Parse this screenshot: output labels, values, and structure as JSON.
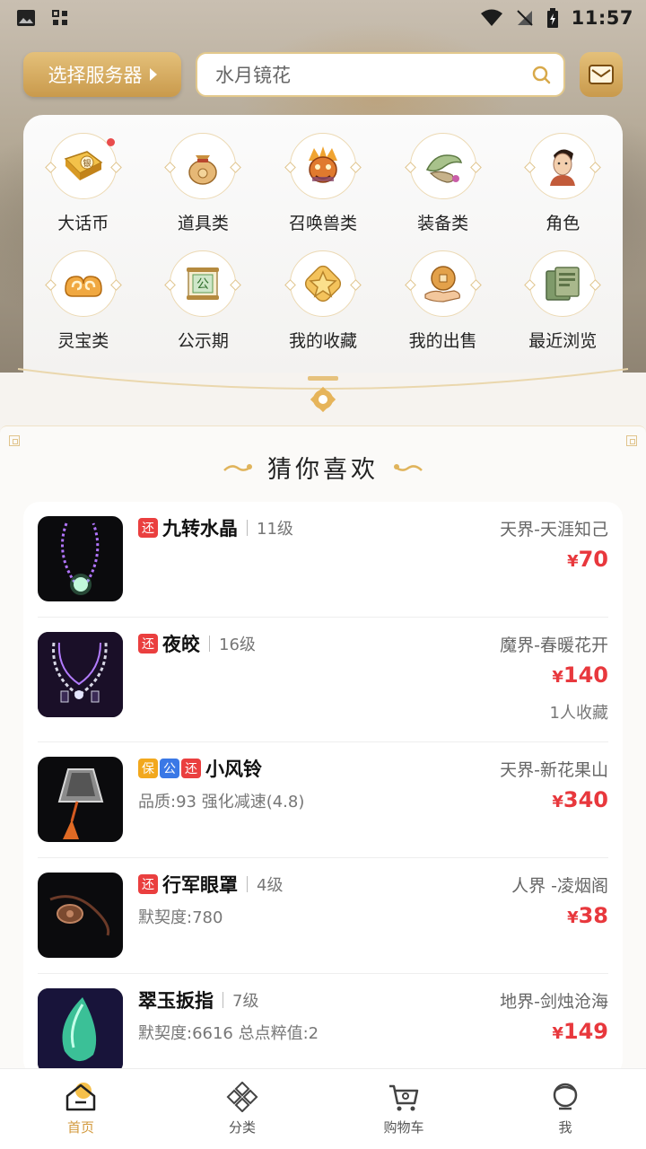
{
  "status_bar": {
    "time": "11:57"
  },
  "top_bar": {
    "server_button_label": "选择服务器",
    "search_text": "水月镜花"
  },
  "categories": [
    {
      "label": "大话币",
      "icon": "silver-ingot-icon",
      "badge_dot": true
    },
    {
      "label": "道具类",
      "icon": "money-bag-icon"
    },
    {
      "label": "召唤兽类",
      "icon": "beast-mask-icon"
    },
    {
      "label": "装备类",
      "icon": "jade-pendant-icon"
    },
    {
      "label": "角色",
      "icon": "character-head-icon"
    },
    {
      "label": "灵宝类",
      "icon": "cloud-swirl-icon"
    },
    {
      "label": "公示期",
      "icon": "announcement-scroll-icon"
    },
    {
      "label": "我的收藏",
      "icon": "star-icon"
    },
    {
      "label": "我的出售",
      "icon": "coin-hand-icon"
    },
    {
      "label": "最近浏览",
      "icon": "book-icon"
    }
  ],
  "recommend": {
    "title": "猜你喜欢",
    "items": [
      {
        "tags": [
          "还"
        ],
        "name": "九转水晶",
        "level": "11级",
        "desc": "",
        "server": "天界-天涯知己",
        "price": "70",
        "fav": ""
      },
      {
        "tags": [
          "还"
        ],
        "name": "夜皎",
        "level": "16级",
        "desc": "",
        "server": "魔界-春暖花开",
        "price": "140",
        "fav": "1人收藏"
      },
      {
        "tags": [
          "保",
          "公",
          "还"
        ],
        "name": "小风铃",
        "level": "",
        "desc": "品质:93 强化减速(4.8)",
        "server": "天界-新花果山",
        "price": "340",
        "fav": ""
      },
      {
        "tags": [
          "还"
        ],
        "name": "行军眼罩",
        "level": "4级",
        "desc": "默契度:780",
        "server": "人界 -凌烟阁",
        "price": "38",
        "fav": ""
      },
      {
        "tags": [],
        "name": "翠玉扳指",
        "level": "7级",
        "desc": "默契度:6616 总点粹值:2",
        "server": "地界-剑烛沧海",
        "price": "149",
        "fav": ""
      }
    ],
    "currency_symbol": "¥"
  },
  "bottom_nav": [
    {
      "label": "首页",
      "icon": "home-icon",
      "active": true
    },
    {
      "label": "分类",
      "icon": "category-icon",
      "active": false
    },
    {
      "label": "购物车",
      "icon": "cart-icon",
      "active": false
    },
    {
      "label": "我",
      "icon": "profile-icon",
      "active": false
    }
  ],
  "colors": {
    "accent_gold": "#d39a3e",
    "price_red": "#e8383d",
    "tag_red": "#ea3f3f",
    "tag_yellow": "#f2a81d",
    "tag_blue": "#3a78e6"
  }
}
